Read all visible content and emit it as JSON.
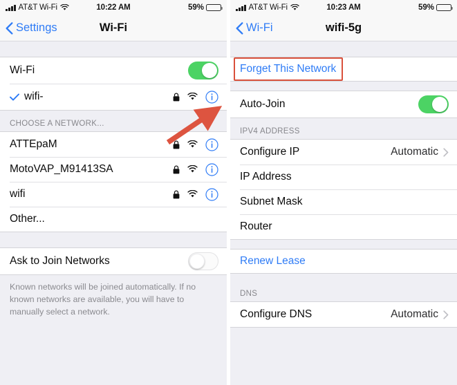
{
  "left_phone": {
    "status_bar": {
      "signal_icon": "signal-bars-icon",
      "carrier": "AT&T Wi-Fi",
      "wifi_icon": "wifi-icon",
      "time": "10:22 AM",
      "battery_percent": "59%",
      "battery_icon": "battery-icon",
      "battery_level": 59
    },
    "nav": {
      "back_label": "Settings",
      "back_icon": "chevron-left-icon",
      "title": "Wi-Fi"
    },
    "wifi_toggle_row": {
      "label": "Wi-Fi",
      "state": "on"
    },
    "connected_network": {
      "name": "wifi-",
      "check_icon": "checkmark-icon",
      "lock_icon": "lock-icon",
      "signal_icon": "wifi-icon",
      "info_icon": "info-circle-icon"
    },
    "choose_network_header": "CHOOSE A NETWORK...",
    "networks": [
      {
        "name": "ATTEpaM",
        "lock_icon": "lock-icon",
        "signal_icon": "wifi-icon",
        "info_icon": "info-circle-icon",
        "has_icons": true
      },
      {
        "name": "MotoVAP_M91413SA",
        "lock_icon": "lock-icon",
        "signal_icon": "wifi-icon",
        "info_icon": "info-circle-icon",
        "has_icons": true
      },
      {
        "name": "wifi",
        "lock_icon": "lock-icon",
        "signal_icon": "wifi-icon",
        "info_icon": "info-circle-icon",
        "has_icons": true
      },
      {
        "name": "Other...",
        "has_icons": false
      }
    ],
    "ask_to_join": {
      "label": "Ask to Join Networks",
      "state": "off"
    },
    "footer_note": "Known networks will be joined automatically. If no known networks are available, you will have to manually select a network."
  },
  "right_phone": {
    "status_bar": {
      "signal_icon": "signal-bars-icon",
      "carrier": "AT&T Wi-Fi",
      "wifi_icon": "wifi-icon",
      "time": "10:23 AM",
      "battery_percent": "59%",
      "battery_icon": "battery-icon",
      "battery_level": 59
    },
    "nav": {
      "back_label": "Wi-Fi",
      "back_icon": "chevron-left-icon",
      "title": "wifi-5g"
    },
    "forget_network_label": "Forget This Network",
    "auto_join": {
      "label": "Auto-Join",
      "state": "on"
    },
    "ipv4_header": "IPV4 ADDRESS",
    "ipv4_rows": [
      {
        "label": "Configure IP",
        "value": "Automatic",
        "chevron": "chevron-right-icon"
      },
      {
        "label": "IP Address",
        "value": ""
      },
      {
        "label": "Subnet Mask",
        "value": ""
      },
      {
        "label": "Router",
        "value": ""
      }
    ],
    "renew_lease_label": "Renew Lease",
    "dns_header": "DNS",
    "dns_rows": [
      {
        "label": "Configure DNS",
        "value": "Automatic",
        "chevron": "chevron-right-icon"
      }
    ]
  },
  "annotations": {
    "highlight_box_target": "Forget This Network",
    "arrow_target": "info-circle-icon of wifi- network",
    "color": "#D9503B"
  }
}
